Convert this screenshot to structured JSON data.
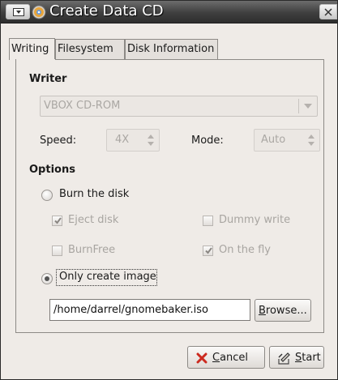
{
  "window": {
    "title": "Create Data CD"
  },
  "tabs": [
    {
      "label": "Writing",
      "active": true
    },
    {
      "label": "Filesystem",
      "active": false
    },
    {
      "label": "Disk Information",
      "active": false
    }
  ],
  "writer": {
    "heading": "Writer",
    "device": "VBOX CD-ROM",
    "speed_label": "Speed:",
    "speed_value": "4X",
    "mode_label": "Mode:",
    "mode_value": "Auto"
  },
  "options": {
    "heading": "Options",
    "burn_disk_label": "Burn the disk",
    "burn_disk_selected": false,
    "eject_disk_label": "Eject disk",
    "eject_disk_checked": true,
    "dummy_write_label": "Dummy write",
    "dummy_write_checked": false,
    "burnfree_label": "BurnFree",
    "burnfree_checked": false,
    "on_the_fly_label": "On the fly",
    "on_the_fly_checked": true,
    "only_create_image_label": "Only create image",
    "only_create_image_selected": true
  },
  "image": {
    "path": "/home/darrel/gnomebaker.iso",
    "browse_label": "Browse...",
    "browse_mnemonic": "B",
    "browse_rest": "rowse..."
  },
  "footer": {
    "cancel_mnemonic": "C",
    "cancel_rest": "ancel",
    "start_mnemonic": "S",
    "start_rest": "tart"
  },
  "colors": {
    "window_bg": "#efebe7",
    "titlebar_bg": "#3f3f3f",
    "cancel_icon": "#cc2a1f"
  },
  "icons": [
    "window-menu-icon",
    "cd-app-icon",
    "close-icon",
    "cancel-x-icon",
    "burn-start-icon"
  ]
}
